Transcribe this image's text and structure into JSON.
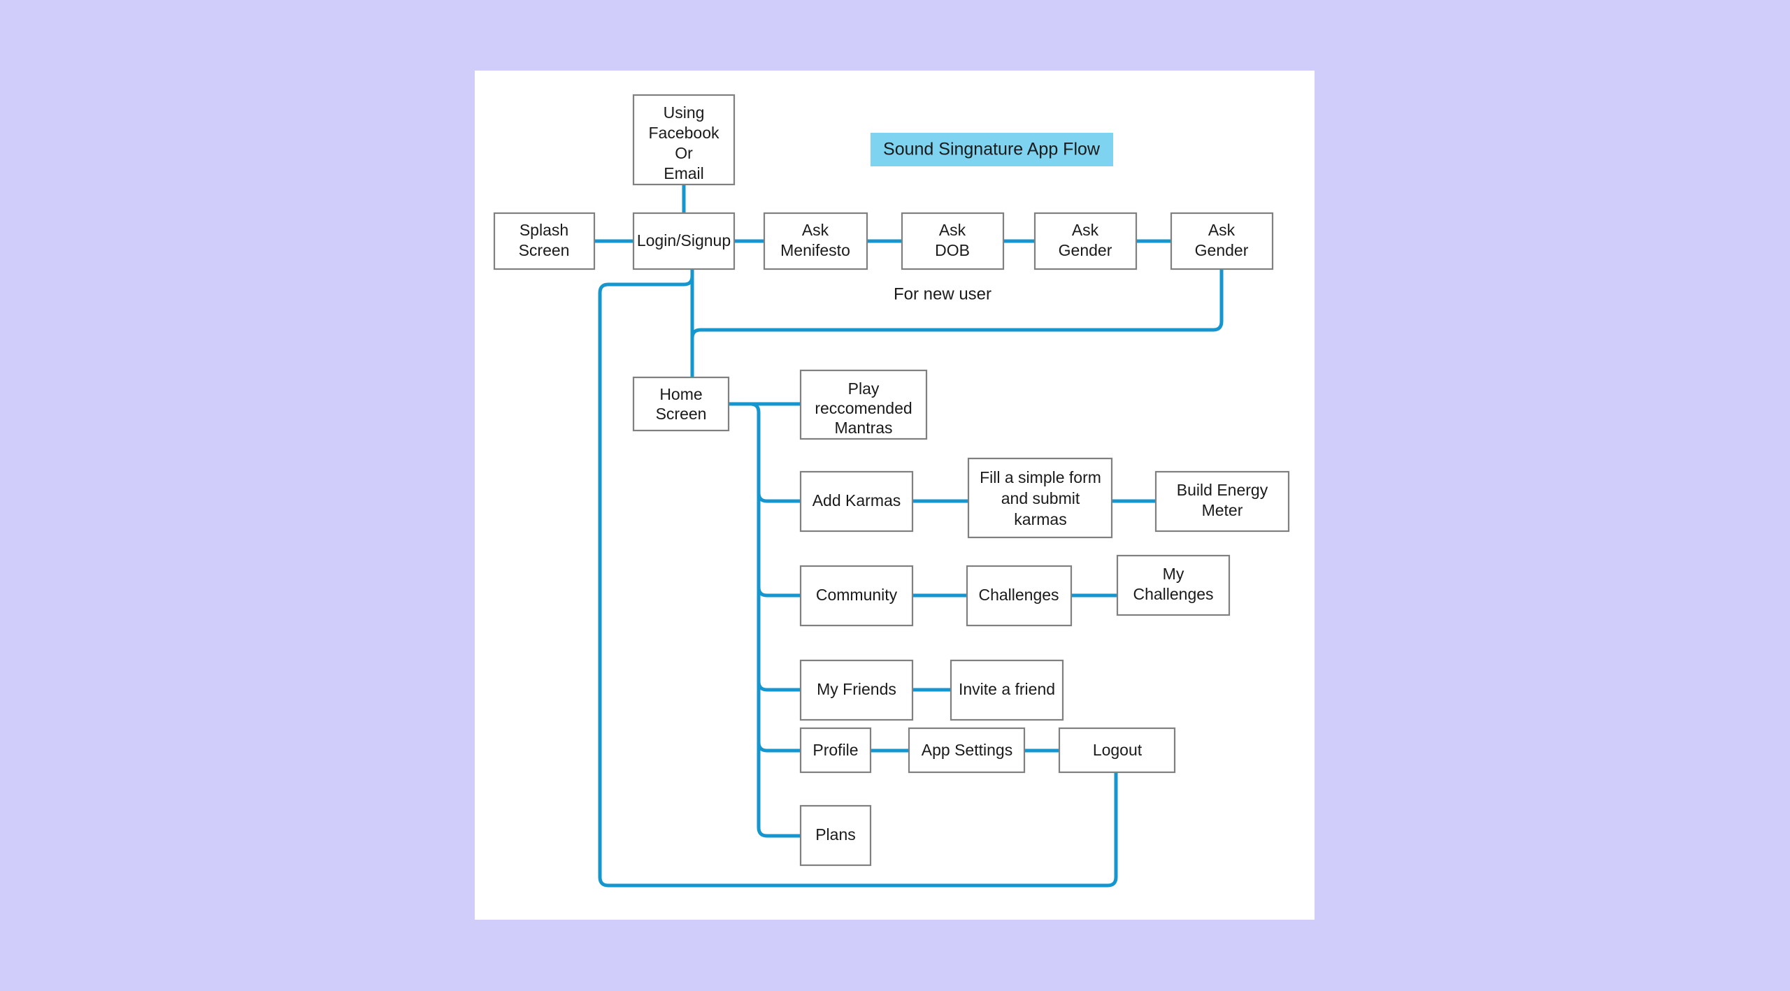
{
  "page": {
    "background_color": "#d0cdfa",
    "canvas_color": "#ffffff"
  },
  "banner": {
    "title": "Sound Singnature App Flow",
    "background_color": "#7dd3f0",
    "text_color": "#1a1a1a"
  },
  "annotations": {
    "for_new_user": "For new user"
  },
  "style": {
    "connector_color": "#1596ce",
    "node_border_color": "#808080",
    "node_fill_color": "#ffffff"
  },
  "nodes": {
    "using_facebook_or_email": {
      "label": "Using\nFacebook\nOr\nEmail",
      "lines": [
        "Using",
        "Facebook",
        "Or",
        "Email"
      ]
    },
    "splash_screen": {
      "label": "Splash Screen",
      "lines": [
        "Splash",
        "Screen"
      ]
    },
    "login_signup": {
      "label": "Login/Signup",
      "lines": [
        "Login/Signup"
      ]
    },
    "ask_menifesto": {
      "label": "Ask Menifesto",
      "lines": [
        "Ask",
        "Menifesto"
      ]
    },
    "ask_dob": {
      "label": "Ask DOB",
      "lines": [
        "Ask",
        "DOB"
      ]
    },
    "ask_gender_1": {
      "label": "Ask Gender",
      "lines": [
        "Ask",
        "Gender"
      ]
    },
    "ask_gender_2": {
      "label": "Ask Gender",
      "lines": [
        "Ask",
        "Gender"
      ]
    },
    "home_screen": {
      "label": "Home Screen",
      "lines": [
        "Home",
        "Screen"
      ]
    },
    "play_recommended_mantras": {
      "label": "Play reccomended Mantras",
      "lines": [
        "Play",
        "reccomended",
        "Mantras"
      ]
    },
    "add_karmas": {
      "label": "Add Karmas",
      "lines": [
        "Add Karmas"
      ]
    },
    "fill_form_submit_karmas": {
      "label": "Fill a simple form and submit karmas",
      "lines": [
        "Fill a simple form",
        "and submit",
        "karmas"
      ]
    },
    "build_energy_meter": {
      "label": "Build Energy Meter",
      "lines": [
        "Build Energy",
        "Meter"
      ]
    },
    "community": {
      "label": "Community",
      "lines": [
        "Community"
      ]
    },
    "challenges": {
      "label": "Challenges",
      "lines": [
        "Challenges"
      ]
    },
    "my_challenges": {
      "label": "My Challenges",
      "lines": [
        "My",
        "Challenges"
      ]
    },
    "my_friends": {
      "label": "My Friends",
      "lines": [
        "My Friends"
      ]
    },
    "invite_a_friend": {
      "label": "Invite a friend",
      "lines": [
        "Invite a friend"
      ]
    },
    "profile": {
      "label": "Profile",
      "lines": [
        "Profile"
      ]
    },
    "app_settings": {
      "label": "App Settings",
      "lines": [
        "App Settings"
      ]
    },
    "logout": {
      "label": "Logout",
      "lines": [
        "Logout"
      ]
    },
    "plans": {
      "label": "Plans",
      "lines": [
        "Plans"
      ]
    }
  }
}
